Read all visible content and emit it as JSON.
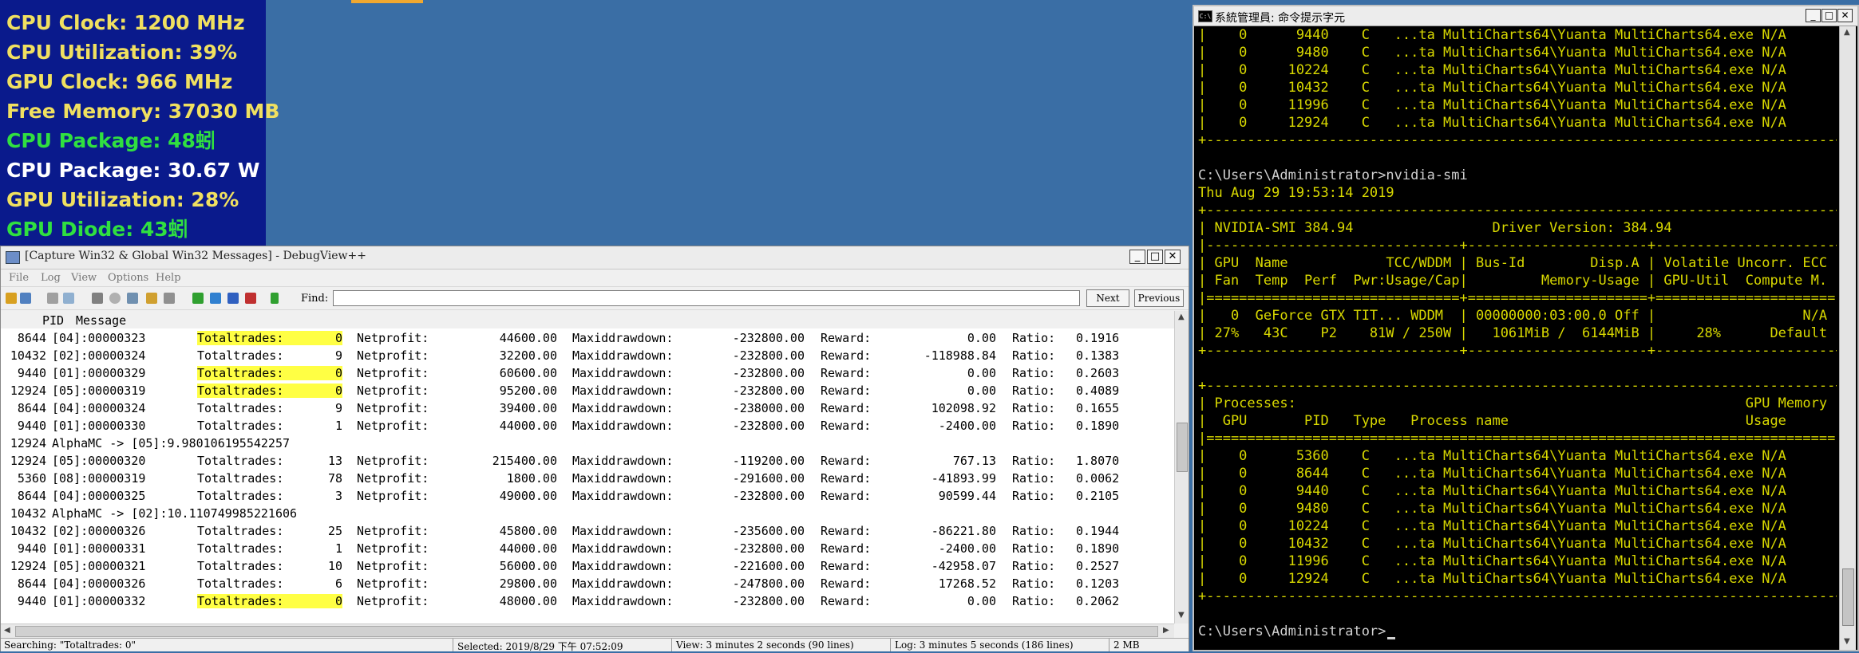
{
  "overlay": {
    "lines": [
      {
        "text": "CPU Clock: 1200 MHz",
        "color": "#f0e060"
      },
      {
        "text": "CPU Utilization: 39%",
        "color": "#f0e060"
      },
      {
        "text": "GPU Clock: 966 MHz",
        "color": "#f0e060"
      },
      {
        "text": "Free Memory: 37030 MB",
        "color": "#f0e060"
      },
      {
        "text": "CPU Package: 48蚓",
        "color": "#30e040"
      },
      {
        "text": "CPU Package: 30.67 W",
        "color": "#ffffff"
      },
      {
        "text": "GPU Utilization: 28%",
        "color": "#f0e060"
      },
      {
        "text": "GPU Diode: 43蚓",
        "color": "#30e040"
      }
    ]
  },
  "debugview": {
    "title": "[Capture Win32 & Global Win32 Messages] - DebugView++",
    "menu": [
      "File",
      "Log",
      "View",
      "Options",
      "Help"
    ],
    "find_label": "Find:",
    "find_value": "",
    "next_label": "Next",
    "previous_label": "Previous",
    "columns": {
      "pid": "PID",
      "message": "Message"
    },
    "rows": [
      {
        "pid": "8644",
        "tag": "[04]:00000323",
        "kind": "trade",
        "trades": "0",
        "hl": true,
        "net": "44600.00",
        "mdd": "-232800.00",
        "reward": "0.00",
        "ratio": "0.1916"
      },
      {
        "pid": "10432",
        "tag": "[02]:00000324",
        "kind": "trade",
        "trades": "9",
        "hl": false,
        "net": "32200.00",
        "mdd": "-232800.00",
        "reward": "-118988.84",
        "ratio": "0.1383"
      },
      {
        "pid": "9440",
        "tag": "[01]:00000329",
        "kind": "trade",
        "trades": "0",
        "hl": true,
        "net": "60600.00",
        "mdd": "-232800.00",
        "reward": "0.00",
        "ratio": "0.2603"
      },
      {
        "pid": "12924",
        "tag": "[05]:00000319",
        "kind": "trade",
        "trades": "0",
        "hl": true,
        "net": "95200.00",
        "mdd": "-232800.00",
        "reward": "0.00",
        "ratio": "0.4089"
      },
      {
        "pid": "8644",
        "tag": "[04]:00000324",
        "kind": "trade",
        "trades": "9",
        "hl": false,
        "net": "39400.00",
        "mdd": "-238000.00",
        "reward": "102098.92",
        "ratio": "0.1655"
      },
      {
        "pid": "9440",
        "tag": "[01]:00000330",
        "kind": "trade",
        "trades": "1",
        "hl": false,
        "net": "44000.00",
        "mdd": "-232800.00",
        "reward": "-2400.00",
        "ratio": "0.1890"
      },
      {
        "pid": "12924",
        "kind": "alpha",
        "text": "AlphaMC -> [05]:9.980106195542257"
      },
      {
        "pid": "12924",
        "tag": "[05]:00000320",
        "kind": "trade",
        "trades": "13",
        "hl": false,
        "net": "215400.00",
        "mdd": "-119200.00",
        "reward": "767.13",
        "ratio": "1.8070"
      },
      {
        "pid": "5360",
        "tag": "[08]:00000319",
        "kind": "trade",
        "trades": "78",
        "hl": false,
        "net": "1800.00",
        "mdd": "-291600.00",
        "reward": "-41893.99",
        "ratio": "0.0062"
      },
      {
        "pid": "8644",
        "tag": "[04]:00000325",
        "kind": "trade",
        "trades": "3",
        "hl": false,
        "net": "49000.00",
        "mdd": "-232800.00",
        "reward": "90599.44",
        "ratio": "0.2105"
      },
      {
        "pid": "10432",
        "kind": "alpha",
        "text": "AlphaMC -> [02]:10.110749985221606"
      },
      {
        "pid": "10432",
        "tag": "[02]:00000326",
        "kind": "trade",
        "trades": "25",
        "hl": false,
        "net": "45800.00",
        "mdd": "-235600.00",
        "reward": "-86221.80",
        "ratio": "0.1944"
      },
      {
        "pid": "9440",
        "tag": "[01]:00000331",
        "kind": "trade",
        "trades": "1",
        "hl": false,
        "net": "44000.00",
        "mdd": "-232800.00",
        "reward": "-2400.00",
        "ratio": "0.1890"
      },
      {
        "pid": "12924",
        "tag": "[05]:00000321",
        "kind": "trade",
        "trades": "10",
        "hl": false,
        "net": "56000.00",
        "mdd": "-221600.00",
        "reward": "-42958.07",
        "ratio": "0.2527"
      },
      {
        "pid": "8644",
        "tag": "[04]:00000326",
        "kind": "trade",
        "trades": "6",
        "hl": false,
        "net": "29800.00",
        "mdd": "-247800.00",
        "reward": "17268.52",
        "ratio": "0.1203"
      },
      {
        "pid": "9440",
        "tag": "[01]:00000332",
        "kind": "trade",
        "trades": "0",
        "hl": true,
        "net": "48000.00",
        "mdd": "-232800.00",
        "reward": "0.00",
        "ratio": "0.2062"
      }
    ],
    "labels": {
      "trades": "Totaltrades:",
      "net": "Netprofit:",
      "mdd": "Maxiddrawdown:",
      "reward": "Reward:",
      "ratio": "Ratio:"
    },
    "status": {
      "searching": "Searching: \"Totaltrades:   0\"",
      "selected": "Selected: 2019/8/29 下午 07:52:09",
      "view": "View: 3 minutes 2 seconds (90 lines)",
      "log": "Log: 3 minutes 5 seconds (186 lines)",
      "mem": "2 MB"
    }
  },
  "cmd": {
    "title": "系統管理員: 命令提示字元",
    "lines": [
      {
        "t": "|    0      9440    C   ...ta MultiCharts64\\Yuanta MultiCharts64.exe N/A      |",
        "c": "y"
      },
      {
        "t": "|    0      9480    C   ...ta MultiCharts64\\Yuanta MultiCharts64.exe N/A      |",
        "c": "y"
      },
      {
        "t": "|    0     10224    C   ...ta MultiCharts64\\Yuanta MultiCharts64.exe N/A      |",
        "c": "y"
      },
      {
        "t": "|    0     10432    C   ...ta MultiCharts64\\Yuanta MultiCharts64.exe N/A      |",
        "c": "y"
      },
      {
        "t": "|    0     11996    C   ...ta MultiCharts64\\Yuanta MultiCharts64.exe N/A      |",
        "c": "y"
      },
      {
        "t": "|    0     12924    C   ...ta MultiCharts64\\Yuanta MultiCharts64.exe N/A      |",
        "c": "y"
      },
      {
        "t": "+-----------------------------------------------------------------------------+",
        "c": "y"
      },
      {
        "t": "",
        "c": "y"
      },
      {
        "t": "C:\\Users\\Administrator>nvidia-smi",
        "c": "w"
      },
      {
        "t": "Thu Aug 29 19:53:14 2019",
        "c": "y"
      },
      {
        "t": "+-----------------------------------------------------------------------------+",
        "c": "y"
      },
      {
        "t": "| NVIDIA-SMI 384.94                 Driver Version: 384.94                    |",
        "c": "y"
      },
      {
        "t": "|-------------------------------+----------------------+----------------------+",
        "c": "y"
      },
      {
        "t": "| GPU  Name            TCC/WDDM | Bus-Id        Disp.A | Volatile Uncorr. ECC |",
        "c": "y"
      },
      {
        "t": "| Fan  Temp  Perf  Pwr:Usage/Cap|         Memory-Usage | GPU-Util  Compute M. |",
        "c": "y"
      },
      {
        "t": "|===============================+======================+======================|",
        "c": "y"
      },
      {
        "t": "|   0  GeForce GTX TIT... WDDM  | 00000000:03:00.0 Off |                  N/A |",
        "c": "y"
      },
      {
        "t": "| 27%   43C    P2    81W / 250W |   1061MiB /  6144MiB |     28%      Default |",
        "c": "y"
      },
      {
        "t": "+-------------------------------+----------------------+----------------------+",
        "c": "y"
      },
      {
        "t": "",
        "c": "y"
      },
      {
        "t": "+-----------------------------------------------------------------------------+",
        "c": "y"
      },
      {
        "t": "| Processes:                                                       GPU Memory |",
        "c": "y"
      },
      {
        "t": "|  GPU       PID   Type   Process name                             Usage      |",
        "c": "y"
      },
      {
        "t": "|=============================================================================|",
        "c": "y"
      },
      {
        "t": "|    0      5360    C   ...ta MultiCharts64\\Yuanta MultiCharts64.exe N/A      |",
        "c": "y"
      },
      {
        "t": "|    0      8644    C   ...ta MultiCharts64\\Yuanta MultiCharts64.exe N/A      |",
        "c": "y"
      },
      {
        "t": "|    0      9440    C   ...ta MultiCharts64\\Yuanta MultiCharts64.exe N/A      |",
        "c": "y"
      },
      {
        "t": "|    0      9480    C   ...ta MultiCharts64\\Yuanta MultiCharts64.exe N/A      |",
        "c": "y"
      },
      {
        "t": "|    0     10224    C   ...ta MultiCharts64\\Yuanta MultiCharts64.exe N/A      |",
        "c": "y"
      },
      {
        "t": "|    0     10432    C   ...ta MultiCharts64\\Yuanta MultiCharts64.exe N/A      |",
        "c": "y"
      },
      {
        "t": "|    0     11996    C   ...ta MultiCharts64\\Yuanta MultiCharts64.exe N/A      |",
        "c": "y"
      },
      {
        "t": "|    0     12924    C   ...ta MultiCharts64\\Yuanta MultiCharts64.exe N/A      |",
        "c": "y"
      },
      {
        "t": "+-----------------------------------------------------------------------------+",
        "c": "y"
      },
      {
        "t": "",
        "c": "y"
      },
      {
        "t": "C:\\Users\\Administrator>",
        "c": "w"
      }
    ]
  }
}
